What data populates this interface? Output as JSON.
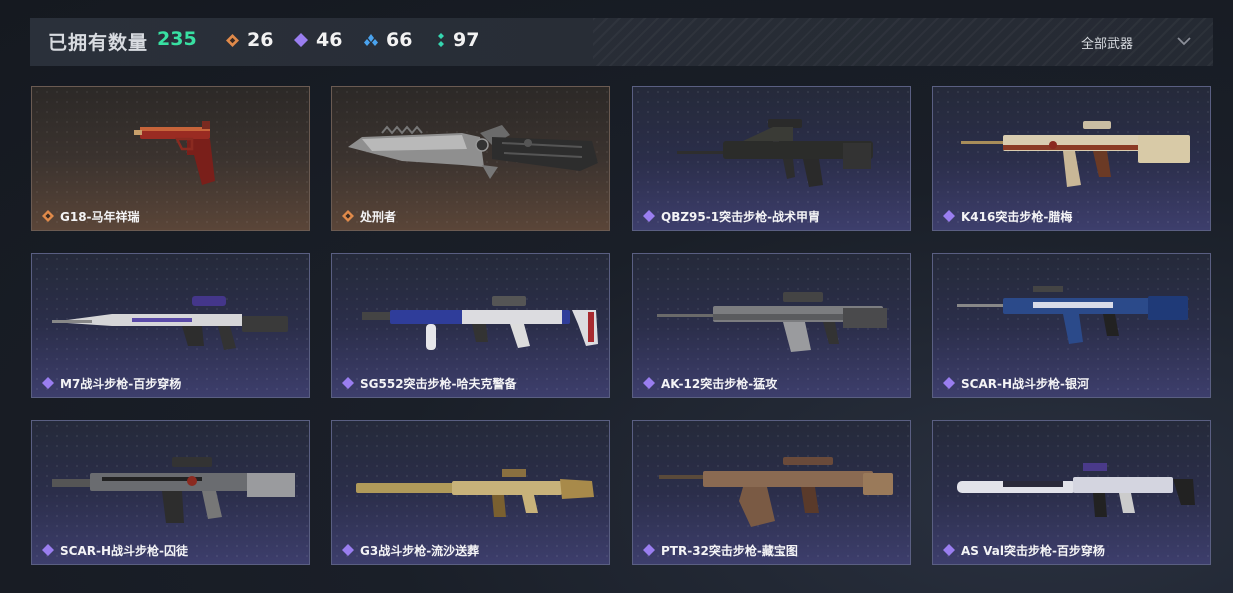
{
  "header": {
    "title": "已拥有数量",
    "total": "235",
    "stats": [
      {
        "icon": "orange-diamond-icon",
        "color": "#e08a4a",
        "value": "26"
      },
      {
        "icon": "purple-diamond-icon",
        "color": "#9a7ef0",
        "value": "46"
      },
      {
        "icon": "blue-diamond-icon",
        "color": "#4aa3ef",
        "value": "66"
      },
      {
        "icon": "teal-diamond-icon",
        "color": "#35d6b0",
        "value": "97"
      }
    ],
    "filter_label": "全部武器"
  },
  "weapons": [
    {
      "name": "G18-马年祥瑞",
      "rarity": "orange",
      "kind": "pistol"
    },
    {
      "name": "处刑者",
      "rarity": "orange",
      "kind": "knife"
    },
    {
      "name": "QBZ95-1突击步枪-战术甲胄",
      "rarity": "purple",
      "kind": "rifle"
    },
    {
      "name": "K416突击步枪-腊梅",
      "rarity": "purple",
      "kind": "rifle"
    },
    {
      "name": "M7战斗步枪-百步穿杨",
      "rarity": "purple",
      "kind": "rifle"
    },
    {
      "name": "SG552突击步枪-哈夫克警备",
      "rarity": "purple",
      "kind": "rifle"
    },
    {
      "name": "AK-12突击步枪-猛攻",
      "rarity": "purple",
      "kind": "rifle"
    },
    {
      "name": "SCAR-H战斗步枪-银河",
      "rarity": "purple",
      "kind": "rifle"
    },
    {
      "name": "SCAR-H战斗步枪-囚徒",
      "rarity": "purple",
      "kind": "rifle"
    },
    {
      "name": "G3战斗步枪-流沙送葬",
      "rarity": "purple",
      "kind": "rifle"
    },
    {
      "name": "PTR-32突击步枪-藏宝图",
      "rarity": "purple",
      "kind": "rifle"
    },
    {
      "name": "AS Val突击步枪-百步穿杨",
      "rarity": "purple",
      "kind": "rifle"
    }
  ],
  "colors": {
    "accent_green": "#38e0a2",
    "rarity_orange": "#e08a4a",
    "rarity_purple": "#9a7ef0"
  }
}
